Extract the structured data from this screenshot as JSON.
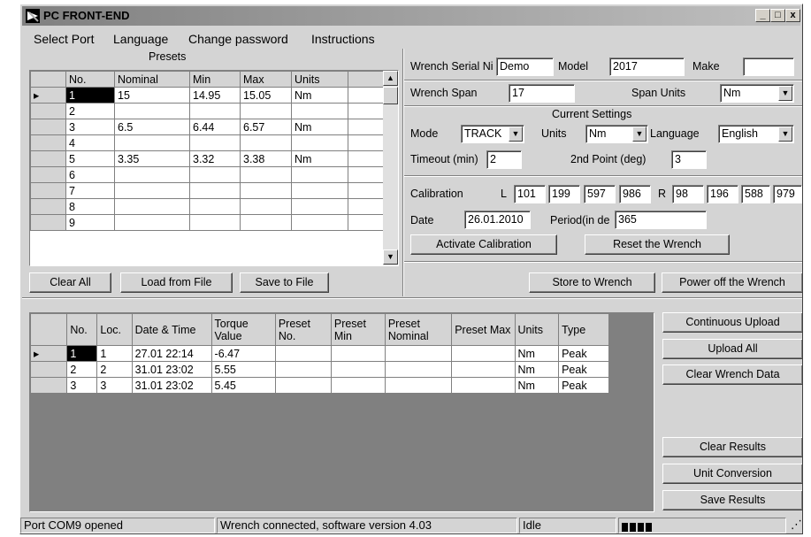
{
  "title": "PC FRONT-END",
  "window_controls": {
    "minimize": "_",
    "maximize": "□",
    "close": "x"
  },
  "menu": [
    "Select Port",
    "Language",
    "Change password",
    "Instructions"
  ],
  "presets": {
    "title": "Presets",
    "columns": [
      "No.",
      "Nominal",
      "Min",
      "Max",
      "Units"
    ],
    "rows": [
      [
        "1",
        "15",
        "14.95",
        "15.05",
        "Nm"
      ],
      [
        "2",
        "",
        "",
        "",
        ""
      ],
      [
        "3",
        "6.5",
        "6.44",
        "6.57",
        "Nm"
      ],
      [
        "4",
        "",
        "",
        "",
        ""
      ],
      [
        "5",
        "3.35",
        "3.32",
        "3.38",
        "Nm"
      ],
      [
        "6",
        "",
        "",
        "",
        ""
      ],
      [
        "7",
        "",
        "",
        "",
        ""
      ],
      [
        "8",
        "",
        "",
        "",
        ""
      ],
      [
        "9",
        "",
        "",
        "",
        ""
      ]
    ],
    "buttons": {
      "clear_all": "Clear All",
      "load": "Load from File",
      "save": "Save to File"
    }
  },
  "wrench": {
    "serial_label": "Wrench Serial Ni",
    "serial_value": "Demo",
    "model_label": "Model",
    "model_value": "2017",
    "make_label": "Make",
    "make_value": "",
    "span_label": "Wrench Span",
    "span_value": "17",
    "span_units_label": "Span Units",
    "span_units_value": "Nm"
  },
  "settings": {
    "title": "Current Settings",
    "mode_label": "Mode",
    "mode_value": "TRACK",
    "units_label": "Units",
    "units_value": "Nm",
    "language_label": "Language",
    "language_value": "English",
    "timeout_label": "Timeout (min)",
    "timeout_value": "2",
    "second_point_label": "2nd Point (deg)",
    "second_point_value": "3"
  },
  "calibration": {
    "label": "Calibration",
    "l_label": "L",
    "l_values": [
      "101",
      "199",
      "597",
      "986"
    ],
    "r_label": "R",
    "r_values": [
      "98",
      "196",
      "588",
      "979"
    ],
    "date_label": "Date",
    "date_value": "26.01.2010",
    "period_label": "Period(in de",
    "period_value": "365",
    "activate_button": "Activate Calibration",
    "reset_button": "Reset the Wrench"
  },
  "actions": {
    "store": "Store to Wrench",
    "power_off": "Power off the Wrench"
  },
  "results": {
    "columns": [
      "No.",
      "Loc.",
      "Date & Time",
      "Torque Value",
      "Preset No.",
      "Preset Min",
      "Preset Nominal",
      "Preset Max",
      "Units",
      "Type"
    ],
    "rows": [
      [
        "1",
        "1",
        "27.01 22:14",
        "-6.47",
        "",
        "",
        "",
        "",
        "Nm",
        "Peak"
      ],
      [
        "2",
        "2",
        "31.01 23:02",
        "5.55",
        "",
        "",
        "",
        "",
        "Nm",
        "Peak"
      ],
      [
        "3",
        "3",
        "31.01 23:02",
        "5.45",
        "",
        "",
        "",
        "",
        "Nm",
        "Peak"
      ]
    ]
  },
  "side_buttons": {
    "continuous_upload": "Continuous Upload",
    "upload_all": "Upload All",
    "clear_wrench_data": "Clear Wrench Data",
    "clear_results": "Clear Results",
    "unit_conversion": "Unit Conversion",
    "save_results": "Save Results"
  },
  "status": {
    "port": "Port COM9 opened",
    "connection": "Wrench connected, software version 4.03",
    "state": "Idle",
    "progress_blocks": 4
  }
}
